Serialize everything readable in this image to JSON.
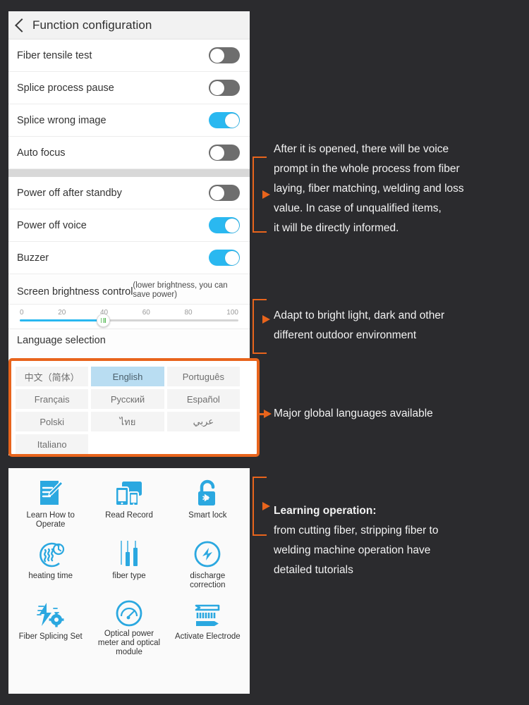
{
  "settings_screen": {
    "nav": {
      "back_icon": "chevron-left-icon",
      "title": "Function configuration"
    },
    "toggle_rows": [
      {
        "label": "Fiber tensile test",
        "state": "off"
      },
      {
        "label": "Splice process pause",
        "state": "off"
      },
      {
        "label": "Splice wrong image",
        "state": "on"
      },
      {
        "label": "Auto focus",
        "state": "off"
      }
    ],
    "toggle_rows_group2": [
      {
        "label": "Power off after standby",
        "state": "off"
      },
      {
        "label": "Power off voice",
        "state": "on"
      },
      {
        "label": "Buzzer",
        "state": "on"
      }
    ],
    "brightness": {
      "label": "Screen brightness control",
      "hint": "(lower brightness, you can save power)",
      "ticks": [
        "0",
        "20",
        "40",
        "60",
        "80",
        "100"
      ],
      "value": 38,
      "min": 0,
      "max": 100,
      "fill_color": "#2ab8f0"
    },
    "language": {
      "heading": "Language selection",
      "selected": "English",
      "options": [
        "中文（简体）",
        "English",
        "Português",
        "Français",
        "Русский",
        "Español",
        "Polski",
        "ไทย",
        "عربي",
        "Italiano"
      ],
      "highlight_color": "#b9ddf2"
    }
  },
  "tools_screen": {
    "items": [
      {
        "label": "Learn How to Operate",
        "icon": "notebook-pencil-icon"
      },
      {
        "label": "Read Record",
        "icon": "devices-icon"
      },
      {
        "label": "Smart lock",
        "icon": "bluetooth-padlock-icon"
      },
      {
        "label": "heating time",
        "icon": "heat-waves-clock-icon"
      },
      {
        "label": "fiber type",
        "icon": "fiber-strands-icon"
      },
      {
        "label": "discharge correction",
        "icon": "lightning-circle-icon"
      },
      {
        "label": "Fiber Splicing Set",
        "icon": "lightning-gear-icon"
      },
      {
        "label": "Optical power meter and optical module",
        "icon": "gauge-icon"
      },
      {
        "label": "Activate Electrode",
        "icon": "electrode-icon"
      }
    ],
    "icon_color": "#2ba8e0"
  },
  "annotations": [
    {
      "id": "voice-prompt-note",
      "text": "After it is opened, there will be voice\nprompt in the whole process from fiber\nlaying, fiber matching, welding and loss\nvalue. In case of unqualified items,\nit will be directly informed."
    },
    {
      "id": "brightness-note",
      "text": "Adapt to bright light, dark and other\ndifferent outdoor environment"
    },
    {
      "id": "language-note",
      "text": "Major global languages available"
    },
    {
      "id": "learning-note-title",
      "text": "Learning operation:"
    },
    {
      "id": "learning-note-body",
      "text": "from cutting fiber, stripping fiber to\nwelding machine operation have\ndetailed tutorials"
    }
  ],
  "theme": {
    "background": "#2b2b2e",
    "accent_orange": "#e8641c",
    "accent_blue": "#2ab8f0",
    "toggle_off": "#6e6e6e"
  }
}
